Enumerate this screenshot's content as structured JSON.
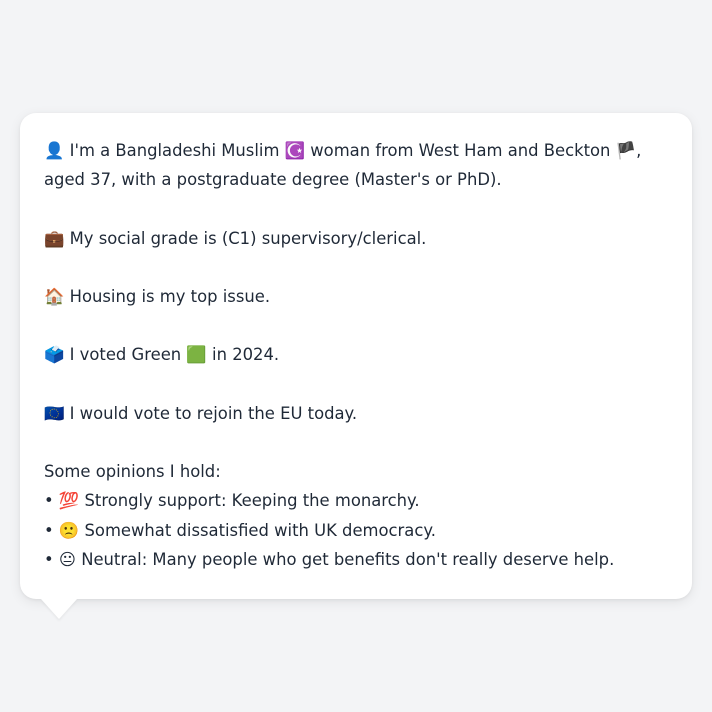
{
  "message": {
    "intro": {
      "icon": "👤",
      "text_a": "I'm a Bangladeshi Muslim",
      "religion_icon": "☪️",
      "text_b": "woman from West Ham and Beckton",
      "flag_icon": "🏴",
      "text_c": ",",
      "line2": "aged 37, with a postgraduate degree (Master's or PhD)."
    },
    "grade": {
      "icon": "💼",
      "text": "My social grade is (C1) supervisory/clerical."
    },
    "issue": {
      "icon": "🏠",
      "text": "Housing is my top issue."
    },
    "vote": {
      "icon": "🗳️",
      "text_a": "I voted Green",
      "party_icon": "🟩",
      "text_b": "in 2024."
    },
    "eu": {
      "icon": "🇪🇺",
      "text": "I would vote to rejoin the EU today."
    },
    "opinions": {
      "heading": "Some opinions I hold:",
      "bullet": "•",
      "items": [
        {
          "icon": "💯",
          "text": "Strongly support: Keeping the monarchy."
        },
        {
          "icon": "🙁",
          "text": "Somewhat dissatisfied with UK democracy."
        },
        {
          "icon": "😐",
          "text": "Neutral: Many people who get benefits don't really deserve help."
        }
      ]
    }
  },
  "colors": {
    "background": "#f3f4f6",
    "bubble": "#ffffff",
    "text": "#1f2937"
  }
}
